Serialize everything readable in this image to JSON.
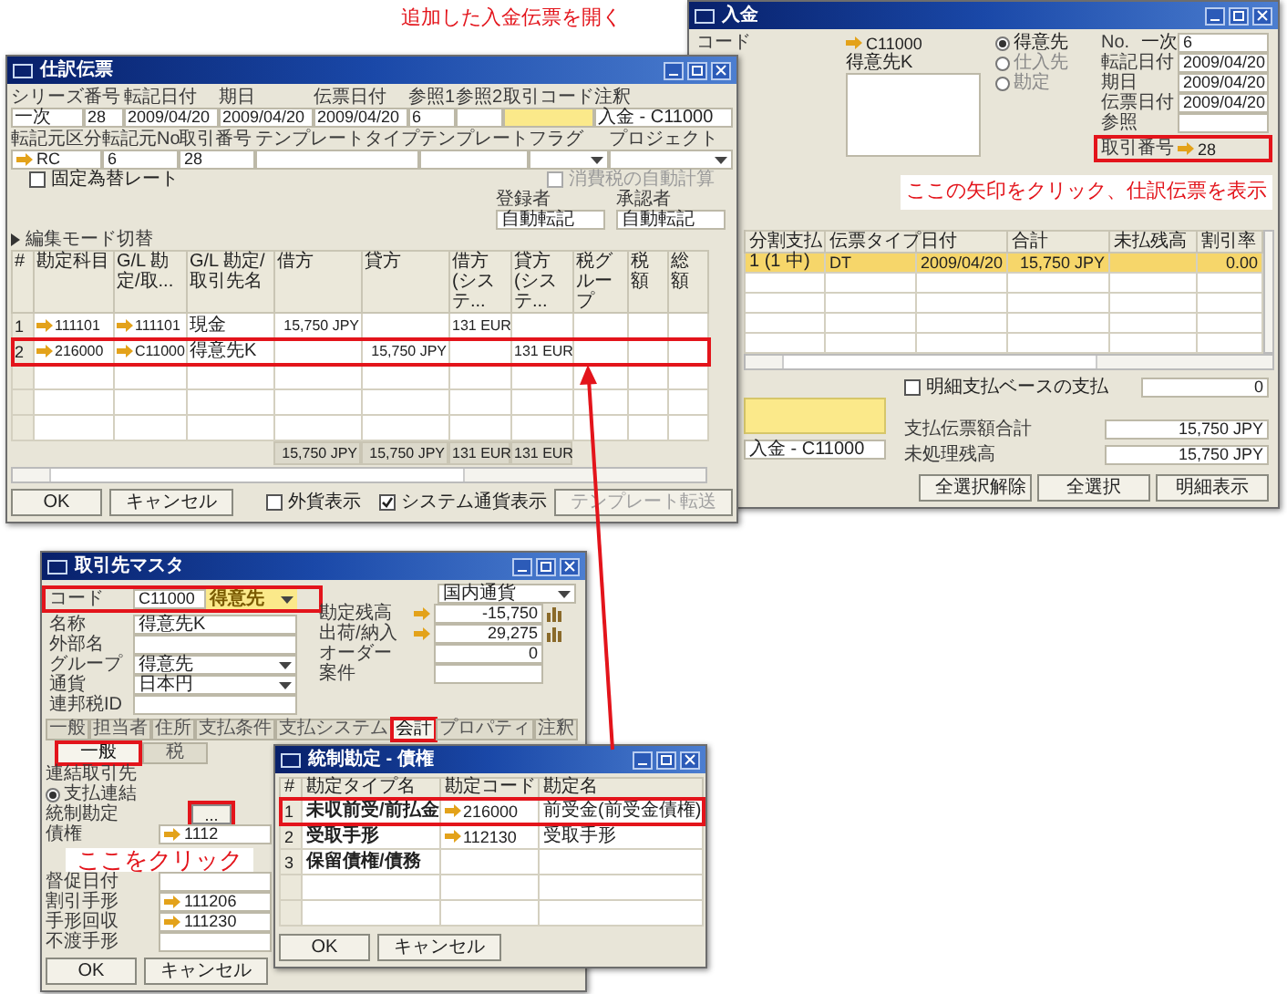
{
  "top_caption": "追加した入金伝票を開く",
  "incoming_payment": {
    "title": "入金",
    "code_label": "コード",
    "code": "C11000",
    "name": "得意先K",
    "radios": [
      {
        "label": "得意先",
        "selected": true
      },
      {
        "label": "仕入先",
        "selected": false
      },
      {
        "label": "勘定",
        "selected": false
      }
    ],
    "fields": [
      {
        "label": "No.",
        "series": "一次",
        "value": "6",
        "kind": "text",
        "marked": false
      },
      {
        "label": "転記日付",
        "value": "2009/04/20",
        "kind": "text",
        "marked": false
      },
      {
        "label": "期日",
        "value": "2009/04/20",
        "kind": "text",
        "marked": false
      },
      {
        "label": "伝票日付",
        "value": "2009/04/20",
        "kind": "text",
        "marked": false
      },
      {
        "label": "参照",
        "kind": "text",
        "marked": false
      },
      {
        "label": "取引番号",
        "value": "28",
        "kind": "link",
        "marked": true
      }
    ],
    "columns": [
      "分割支払",
      "伝票タイプ",
      "日付",
      "合計",
      "未払残高",
      "割引率"
    ],
    "rows": [
      {
        "installment": "1 (1 中)",
        "doc_type": "DT",
        "date": "2009/04/20",
        "total": "15,750 JPY",
        "discount": "0.00",
        "selected": true
      }
    ],
    "line_option": {
      "label": "明細支払ベースの支払",
      "checked": false,
      "value": "0"
    },
    "remarks": "入金 - C11000",
    "totals": [
      {
        "label": "支払伝票額合計",
        "value": "15,750 JPY"
      },
      {
        "label": "未処理残高",
        "value": "15,750 JPY"
      }
    ],
    "buttons": [
      "全選択解除",
      "全選択",
      "明細表示"
    ]
  },
  "payment_callout": "ここの矢印をクリック、仕訳伝票を表示",
  "journal_entry": {
    "title": "仕訳伝票",
    "header_fields": [
      {
        "label": "シリーズ",
        "value": "一次",
        "focused": false
      },
      {
        "label": "番号",
        "value": "28",
        "focused": false
      },
      {
        "label": "転記日付",
        "value": "2009/04/20",
        "focused": false
      },
      {
        "label": "期日",
        "value": "2009/04/20",
        "focused": false
      },
      {
        "label": "伝票日付",
        "value": "2009/04/20",
        "focused": false
      },
      {
        "label": "参照1",
        "value": "6",
        "focused": false
      },
      {
        "label": "参照2",
        "focused": false
      },
      {
        "label": "取引コード",
        "focused": true
      },
      {
        "label": "注釈",
        "value": "入金 - C11000",
        "focused": false
      }
    ],
    "source_fields": [
      {
        "label": "転記元区分",
        "value": "RC",
        "kind": "link"
      },
      {
        "label": "転記元No",
        "value": "6",
        "kind": "text"
      },
      {
        "label": "取引番号",
        "value": "28",
        "kind": "text"
      },
      {
        "label": "テンプレートタイプ",
        "kind": "text"
      },
      {
        "label": "テンプレート",
        "kind": "text"
      },
      {
        "label": "フラグ",
        "kind": "dropdown"
      },
      {
        "label": "プロジェクト",
        "kind": "dropdown"
      }
    ],
    "options": [
      {
        "label": "固定為替レート",
        "checked": false,
        "disabled": false
      },
      {
        "label": "消費税の自動計算",
        "checked": false,
        "disabled": true
      }
    ],
    "signatures": [
      {
        "label": "登録者",
        "value": "自動転記"
      },
      {
        "label": "承認者",
        "value": "自動転記"
      }
    ],
    "section_label": "編集モード切替",
    "columns": [
      "#",
      "勘定科目",
      "G/L 勘定/取...",
      "G/L 勘定/取引先名",
      "借方",
      "貸方",
      "借方 (システ...",
      "貸方 (システ...",
      "税グループ",
      "税額",
      "総額"
    ],
    "rows": [
      {
        "number": "1",
        "account": "111101",
        "gl_account": "111101",
        "gl_name": "現金",
        "debit": "15,750 JPY",
        "debit_sc": "131 EUR",
        "marked": false
      },
      {
        "number": "2",
        "account": "216000",
        "gl_account": "C11000",
        "gl_name": "得意先K",
        "credit": "15,750 JPY",
        "credit_sc": "131 EUR",
        "marked": true
      }
    ],
    "totals": [
      "15,750 JPY",
      "15,750 JPY",
      "131 EUR",
      "131 EUR"
    ],
    "buttons": [
      "OK",
      "キャンセル"
    ],
    "footer_options": [
      {
        "label": "外貨表示",
        "checked": false
      },
      {
        "label": "システム通貨表示",
        "checked": true
      }
    ],
    "template_button": {
      "label": "テンプレート転送",
      "disabled": true
    }
  },
  "bp_master": {
    "title": "取引先マスタ",
    "code": {
      "label": "コード",
      "value": "C11000",
      "type": "得意先",
      "marked": true
    },
    "left_fields": [
      {
        "label": "名称",
        "value": "得意先K",
        "kind": "text"
      },
      {
        "label": "外部名",
        "kind": "text"
      },
      {
        "label": "グループ",
        "value": "得意先",
        "kind": "dropdown"
      },
      {
        "label": "通貨",
        "value": "日本円",
        "kind": "dropdown"
      },
      {
        "label": "連邦税ID",
        "kind": "text"
      }
    ],
    "currency_select": "国内通貨",
    "right_fields": [
      {
        "label": "勘定残高",
        "value": "-15,750",
        "kind": "link"
      },
      {
        "label": "出荷/納入",
        "value": "29,275",
        "kind": "link"
      },
      {
        "label": "オーダー",
        "value": "0",
        "kind": "text"
      },
      {
        "label": "案件",
        "kind": "text"
      }
    ],
    "tabs": [
      {
        "label": "一般",
        "selected": false,
        "marked": false
      },
      {
        "label": "担当者",
        "selected": false,
        "marked": false
      },
      {
        "label": "住所",
        "selected": false,
        "marked": false
      },
      {
        "label": "支払条件",
        "selected": false,
        "marked": false
      },
      {
        "label": "支払システム",
        "selected": false,
        "marked": false
      },
      {
        "label": "会計",
        "selected": true,
        "marked": true
      },
      {
        "label": "プロパティ",
        "selected": false,
        "marked": false
      },
      {
        "label": "注釈",
        "selected": false,
        "marked": false
      }
    ],
    "subtabs": [
      {
        "label": "一般",
        "selected": true,
        "marked": true
      },
      {
        "label": "税",
        "selected": false,
        "marked": false
      }
    ],
    "account_rows": [
      {
        "label": "連結取引先",
        "kind": "label"
      },
      {
        "label": "支払連結",
        "kind": "radio",
        "selected": true
      },
      {
        "label": "統制勘定",
        "kind": "button",
        "button": "...",
        "marked": true
      },
      {
        "label": "債権",
        "kind": "link",
        "value": "1112"
      }
    ],
    "bill_rows": [
      {
        "label": "督促日付",
        "kind": "field"
      },
      {
        "label": "割引手形",
        "kind": "link",
        "value": "111206"
      },
      {
        "label": "手形回収",
        "kind": "link",
        "value": "111230"
      },
      {
        "label": "不渡手形",
        "kind": "field"
      }
    ],
    "buttons": [
      "OK",
      "キャンセル"
    ]
  },
  "click_callout": "ここをクリック",
  "control_accounts": {
    "title": "統制勘定 - 債権",
    "columns": [
      "#",
      "勘定タイプ名",
      "勘定コード",
      "勘定名"
    ],
    "rows": [
      {
        "number": "1",
        "type": "未収前受/前払金",
        "code": "216000",
        "name": "前受金(前受金債権)",
        "marked": true
      },
      {
        "number": "2",
        "type": "受取手形",
        "code": "112130",
        "name": "受取手形",
        "marked": false
      },
      {
        "number": "3",
        "type": "保留債権/債務",
        "marked": false
      }
    ],
    "buttons": [
      "OK",
      "キャンセル"
    ]
  }
}
